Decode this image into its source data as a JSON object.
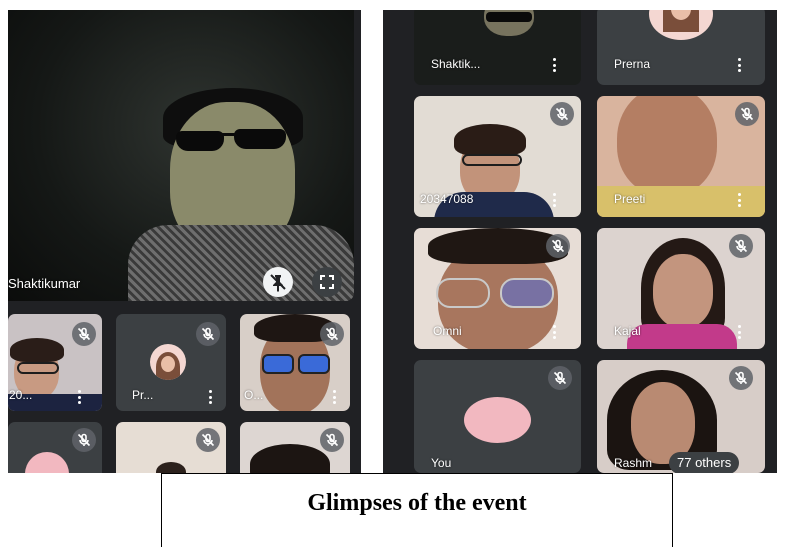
{
  "caption": "Glimpses of the event",
  "left_panel": {
    "main_speaker": {
      "name": "Shaktikumar"
    },
    "tiles": [
      {
        "name": "20..."
      },
      {
        "name": "Pr..."
      },
      {
        "name": "O..."
      }
    ]
  },
  "right_panel": {
    "tiles": [
      {
        "name": "Shaktik..."
      },
      {
        "name": "Prerna"
      },
      {
        "name": "20347088"
      },
      {
        "name": "Preeti"
      },
      {
        "name": "Omni"
      },
      {
        "name": "Kajal"
      },
      {
        "name": "You"
      },
      {
        "name": "Rashm"
      }
    ],
    "others_badge": "77 others"
  },
  "colors": {
    "call_bg": "#202124",
    "tile_bg": "#3c4043",
    "avatar_pink": "#f2b8c0"
  },
  "icons": [
    "mic-off-icon",
    "more-vert-icon",
    "pin-off-icon",
    "fullscreen-icon"
  ]
}
